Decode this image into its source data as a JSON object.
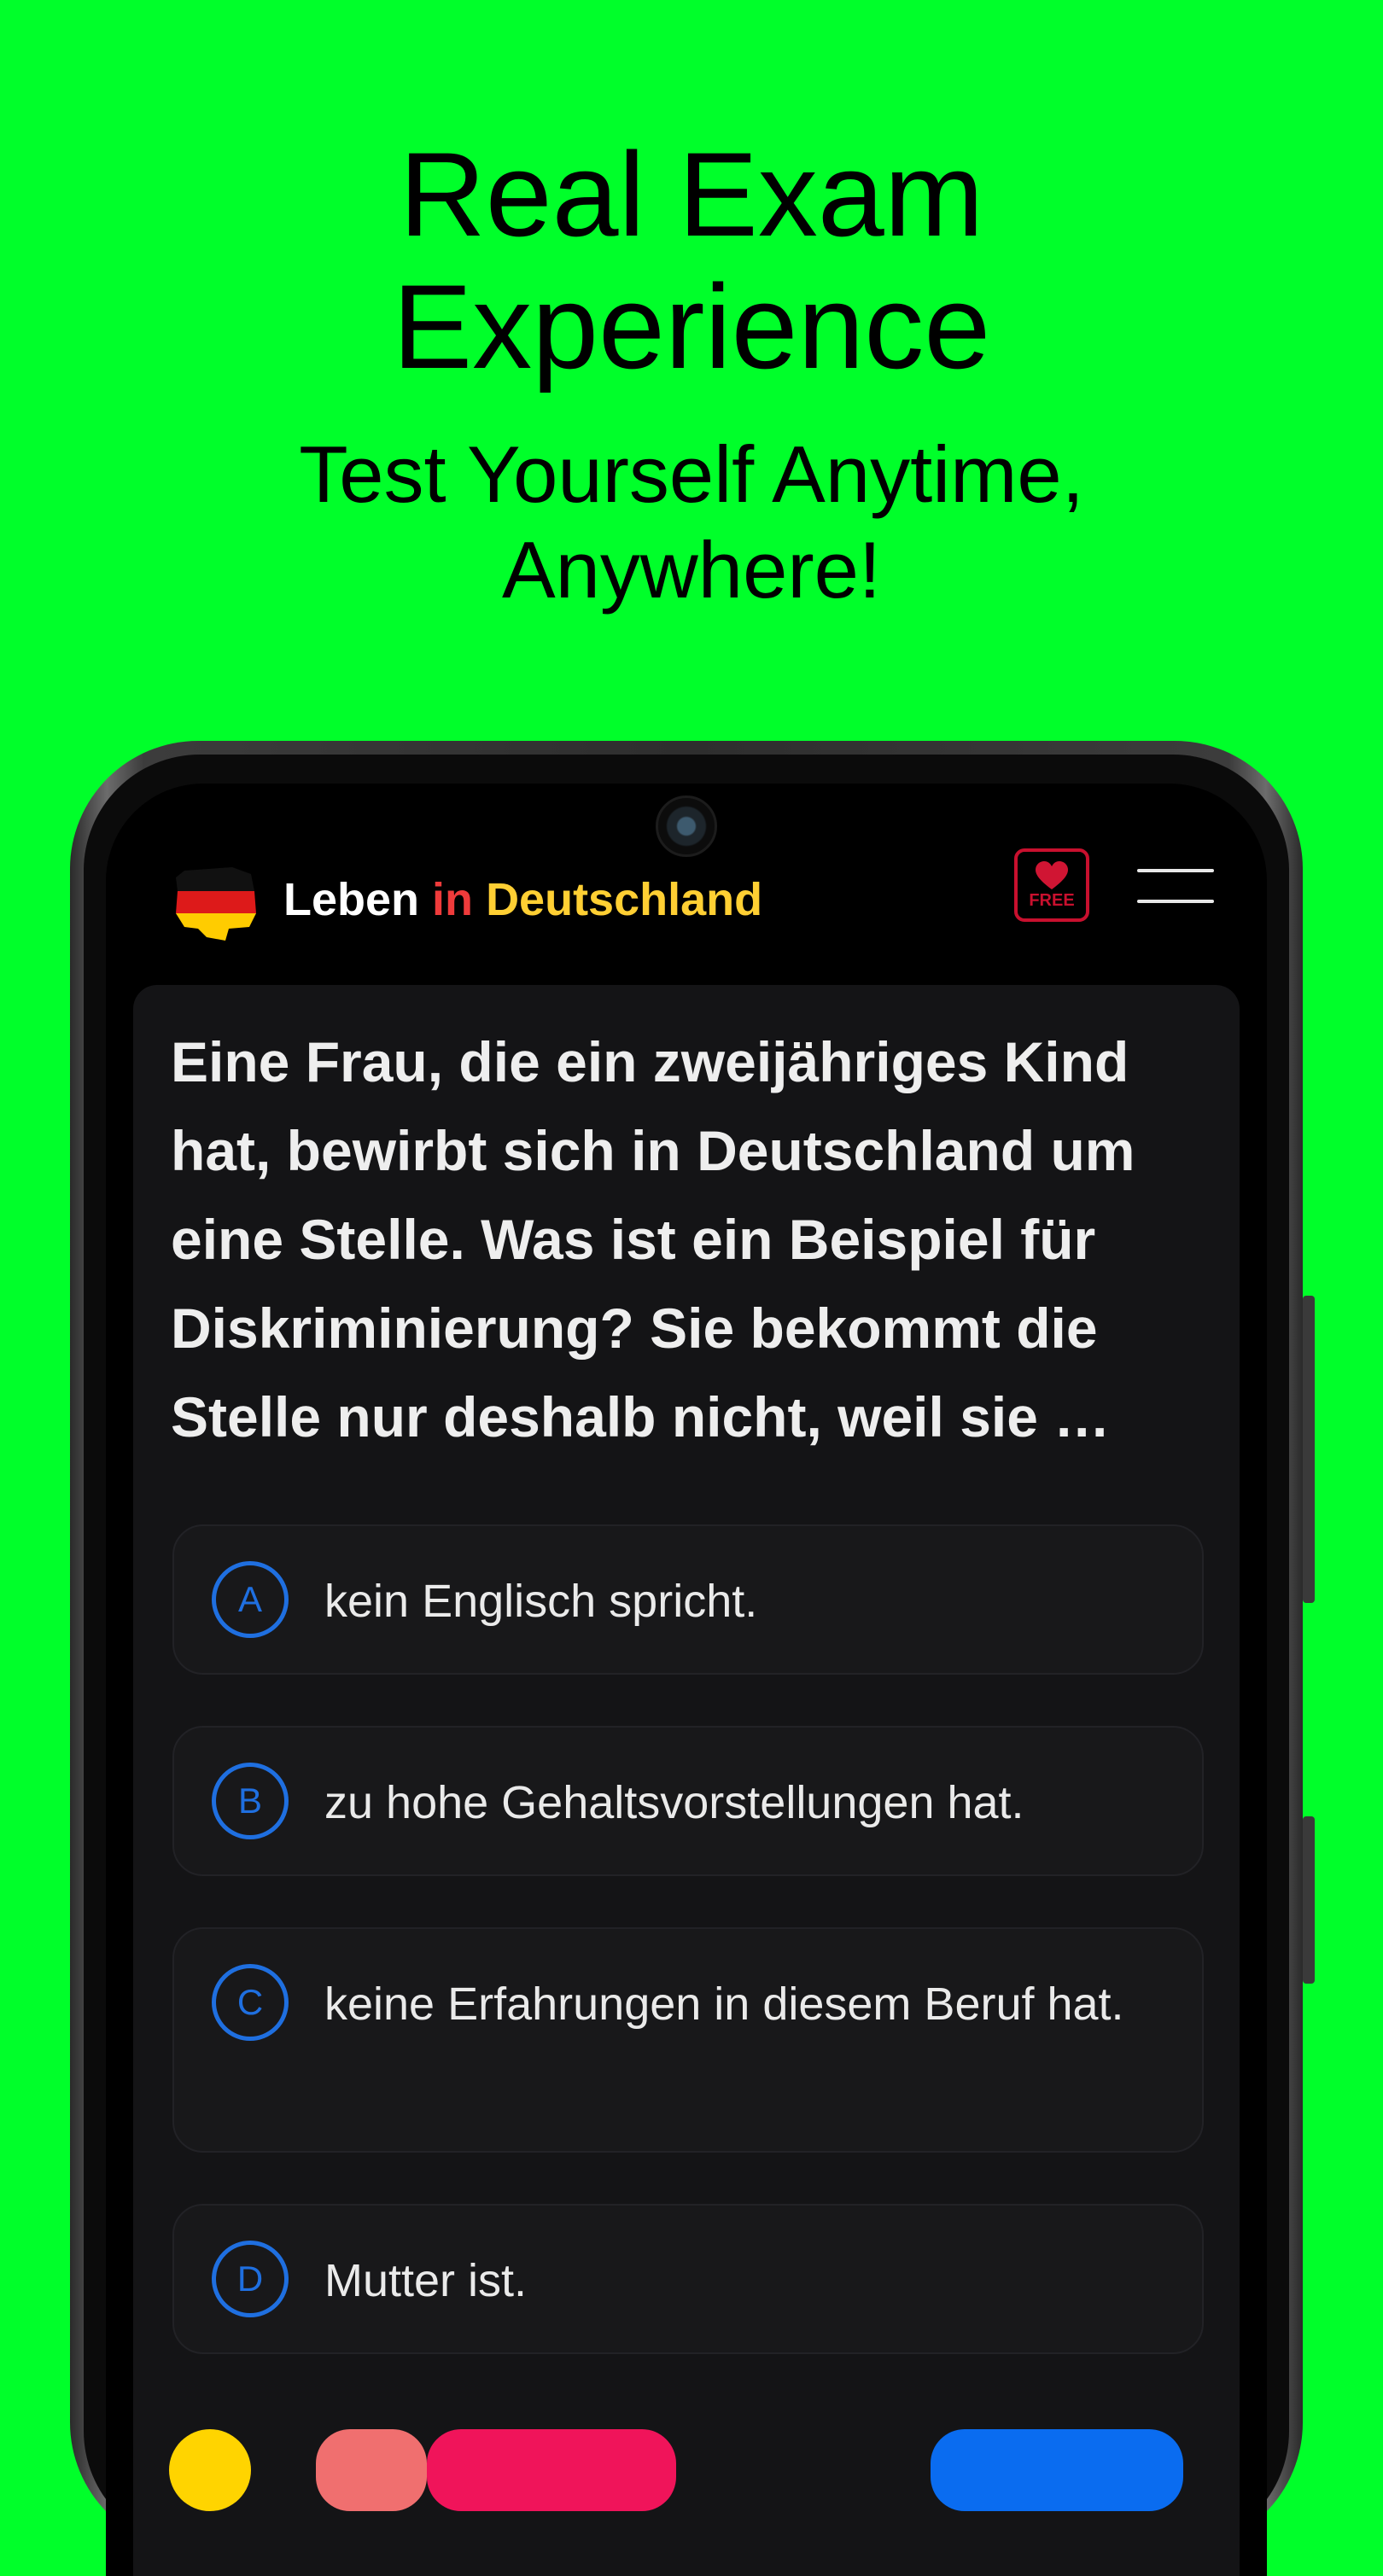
{
  "promo": {
    "headline": "Real Exam\nExperience",
    "subheadline": "Test Yourself Anytime,\nAnywhere!"
  },
  "app": {
    "brand_part1": "Leben",
    "brand_part2": "in",
    "brand_part3": "Deutschland",
    "free_badge": "FREE",
    "icons": {
      "flag": "germany-map-flag-icon",
      "free": "heart-free-icon",
      "menu": "hamburger-menu-icon"
    }
  },
  "question": {
    "text": "Eine Frau, die ein zweijähriges Kind hat, bewirbt sich in Deutschland um eine Stelle. Was ist ein Beispiel für Diskriminierung? Sie bekommt die Stelle nur deshalb nicht, weil sie …"
  },
  "options": [
    {
      "letter": "A",
      "text": "kein Englisch spricht."
    },
    {
      "letter": "B",
      "text": "zu hohe Gehaltsvorstellungen hat."
    },
    {
      "letter": "C",
      "text": "keine Erfahrungen in diesem Beruf hat."
    },
    {
      "letter": "D",
      "text": "Mutter ist."
    }
  ],
  "colors": {
    "background": "#00ff2a",
    "accent_blue": "#1f6fe0",
    "brand_red": "#ef3b3b",
    "brand_yellow": "#ffcf33",
    "badge_red": "#c8102e"
  }
}
